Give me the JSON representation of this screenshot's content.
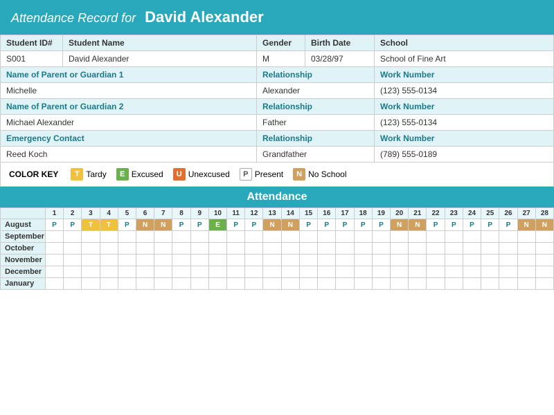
{
  "header": {
    "prefix": "Attendance Record for",
    "name": "David Alexander"
  },
  "student": {
    "id_label": "Student ID#",
    "name_label": "Student Name",
    "gender_label": "Gender",
    "birthdate_label": "Birth Date",
    "school_label": "School",
    "id_value": "S001",
    "name_value": "David Alexander",
    "gender_value": "M",
    "birthdate_value": "03/28/97",
    "school_value": "School of Fine Art"
  },
  "guardian1": {
    "label": "Name of Parent or Guardian 1",
    "rel_label": "Relationship",
    "work_label": "Work Number",
    "name_value": "Michelle",
    "rel_value": "Alexander",
    "work_value": "(123) 555-0134"
  },
  "guardian2": {
    "label": "Name of Parent or Guardian 2",
    "rel_label": "Relationship",
    "work_label": "Work Number",
    "name_value": "Michael Alexander",
    "rel_value": "Father",
    "work_value": "(123) 555-0134"
  },
  "emergency": {
    "label": "Emergency Contact",
    "rel_label": "Relationship",
    "work_label": "Work Number",
    "name_value": "Reed Koch",
    "rel_value": "Grandfather",
    "work_value": "(789) 555-0189"
  },
  "color_key": {
    "label": "COLOR KEY",
    "items": [
      {
        "code": "T",
        "label": "Tardy",
        "type": "tardy"
      },
      {
        "code": "E",
        "label": "Excused",
        "type": "excused"
      },
      {
        "code": "U",
        "label": "Unexcused",
        "type": "unexcused"
      },
      {
        "code": "P",
        "label": "Present",
        "type": "present"
      },
      {
        "code": "N",
        "label": "No School",
        "type": "noschool"
      }
    ]
  },
  "attendance": {
    "title": "Attendance",
    "days": [
      1,
      2,
      3,
      4,
      5,
      6,
      7,
      8,
      9,
      10,
      11,
      12,
      13,
      14,
      15,
      16,
      17,
      18,
      19,
      20,
      21,
      22,
      23,
      24,
      25,
      26,
      27,
      28
    ],
    "months": [
      {
        "name": "August",
        "data": [
          "P",
          "P",
          "T",
          "T",
          "P",
          "N",
          "N",
          "P",
          "P",
          "E",
          "P",
          "P",
          "N",
          "N",
          "P",
          "P",
          "P",
          "P",
          "P",
          "N",
          "N",
          "P",
          "P",
          "P",
          "P",
          "P",
          "N",
          "N"
        ]
      },
      {
        "name": "September",
        "data": [
          "",
          "",
          "",
          "",
          "",
          "",
          "",
          "",
          "",
          "",
          "",
          "",
          "",
          "",
          "",
          "",
          "",
          "",
          "",
          "",
          "",
          "",
          "",
          "",
          "",
          "",
          "",
          ""
        ]
      },
      {
        "name": "October",
        "data": [
          "",
          "",
          "",
          "",
          "",
          "",
          "",
          "",
          "",
          "",
          "",
          "",
          "",
          "",
          "",
          "",
          "",
          "",
          "",
          "",
          "",
          "",
          "",
          "",
          "",
          "",
          "",
          ""
        ]
      },
      {
        "name": "November",
        "data": [
          "",
          "",
          "",
          "",
          "",
          "",
          "",
          "",
          "",
          "",
          "",
          "",
          "",
          "",
          "",
          "",
          "",
          "",
          "",
          "",
          "",
          "",
          "",
          "",
          "",
          "",
          "",
          ""
        ]
      },
      {
        "name": "December",
        "data": [
          "",
          "",
          "",
          "",
          "",
          "",
          "",
          "",
          "",
          "",
          "",
          "",
          "",
          "",
          "",
          "",
          "",
          "",
          "",
          "",
          "",
          "",
          "",
          "",
          "",
          "",
          "",
          ""
        ]
      },
      {
        "name": "January",
        "data": [
          "",
          "",
          "",
          "",
          "",
          "",
          "",
          "",
          "",
          "",
          "",
          "",
          "",
          "",
          "",
          "",
          "",
          "",
          "",
          "",
          "",
          "",
          "",
          "",
          "",
          "",
          "",
          ""
        ]
      }
    ]
  }
}
